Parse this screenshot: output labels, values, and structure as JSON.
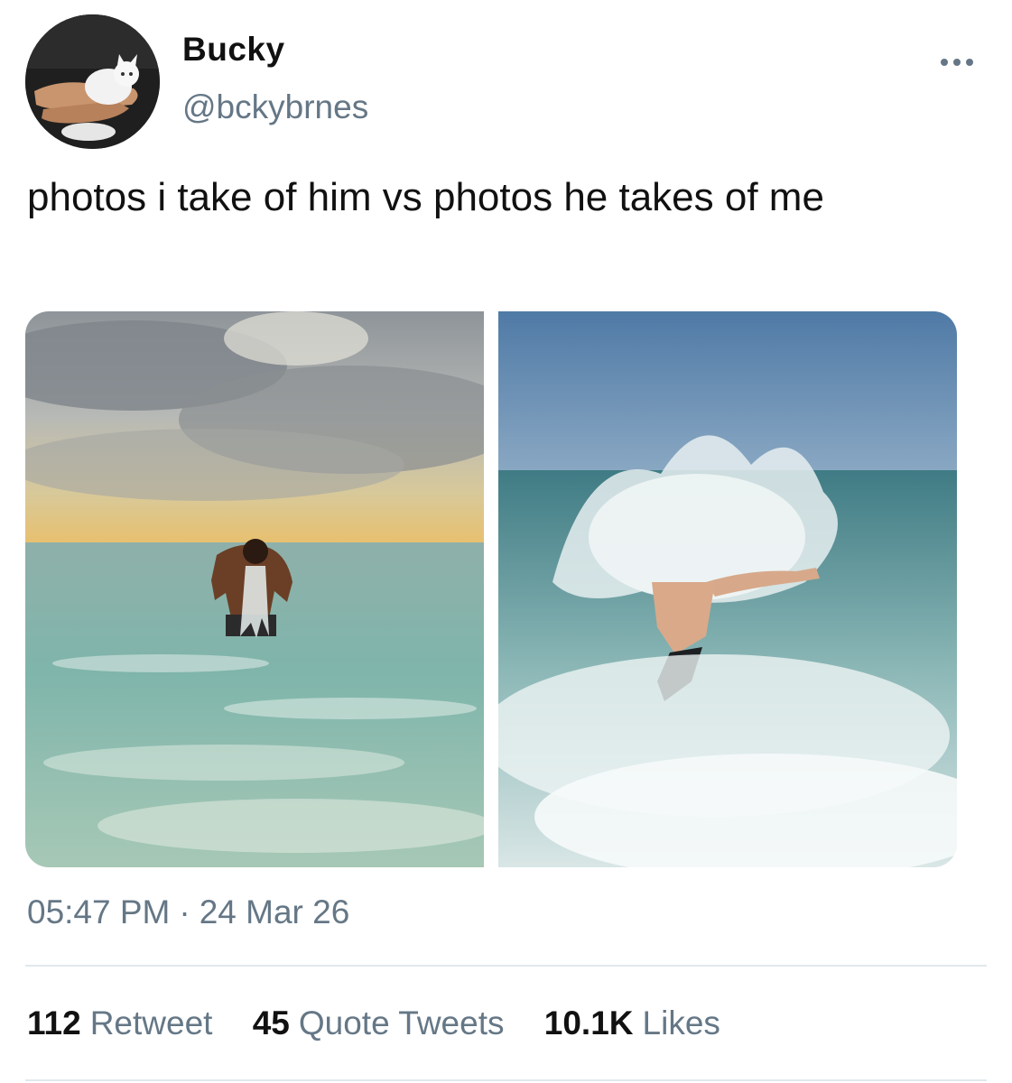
{
  "author": {
    "display_name": "Bucky",
    "handle": "@bckybrnes",
    "avatar_icon": "avatar-person-holding-white-kitten"
  },
  "tweet": {
    "text": "photos i take of him vs photos he takes of me",
    "time": "05:47 PM",
    "separator": "·",
    "date": "24 Mar 26"
  },
  "media": {
    "photos": [
      {
        "icon": "photo-man-splashing-face-in-calm-sea"
      },
      {
        "icon": "photo-person-jumping-into-splashing-wave"
      }
    ]
  },
  "stats": {
    "retweets_count": "112",
    "retweets_label": "Retweet",
    "quotes_count": "45",
    "quotes_label": "Quote Tweets",
    "likes_count": "10.1K",
    "likes_label": "Likes"
  },
  "colors": {
    "text_primary": "#111111",
    "text_secondary": "#657786",
    "divider": "#e1e8ed"
  }
}
